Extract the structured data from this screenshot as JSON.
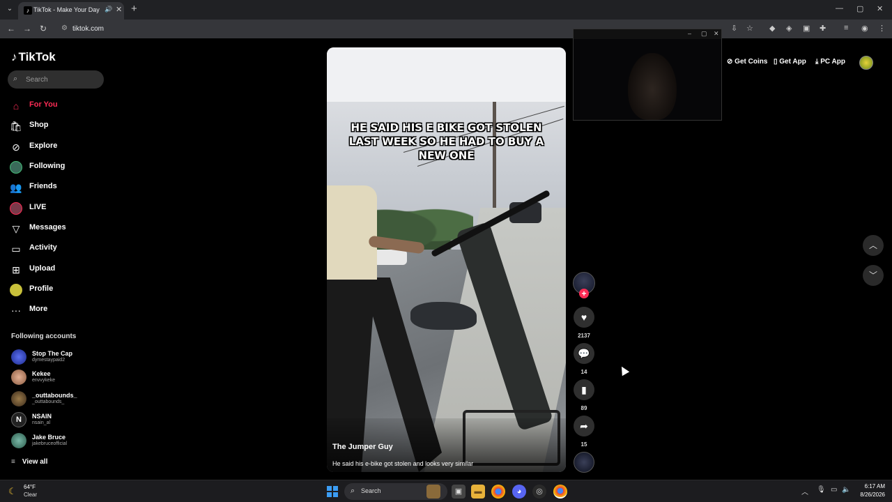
{
  "browser": {
    "tab_title": "TikTok - Make Your Day",
    "address": "tiktok.com"
  },
  "sidebar": {
    "logo": "TikTok",
    "search_placeholder": "Search",
    "nav": [
      {
        "label": "For You",
        "icon": "home-icon",
        "active": true
      },
      {
        "label": "Shop",
        "icon": "shopping-bag-icon"
      },
      {
        "label": "Explore",
        "icon": "compass-icon"
      },
      {
        "label": "Following",
        "icon": "following-avatar-icon"
      },
      {
        "label": "Friends",
        "icon": "friends-icon"
      },
      {
        "label": "LIVE",
        "icon": "live-avatar-icon"
      },
      {
        "label": "Messages",
        "icon": "send-icon"
      },
      {
        "label": "Activity",
        "icon": "inbox-icon"
      },
      {
        "label": "Upload",
        "icon": "plus-square-icon"
      },
      {
        "label": "Profile",
        "icon": "profile-avatar-icon"
      },
      {
        "label": "More",
        "icon": "more-dots-icon"
      }
    ],
    "following_title": "Following accounts",
    "accounts": [
      {
        "name": "Stop The Cap",
        "handle": "dymestaypaid2",
        "color": "#3a4fd6"
      },
      {
        "name": "Kekee",
        "handle": "envvykeke",
        "color": "#c98b6b"
      },
      {
        "name": "_outtabounds_",
        "handle": "_outtabounds_",
        "color": "#6a4a2a"
      },
      {
        "name": "NSAIN",
        "handle": "nsain_al",
        "color": "#2a2a2a"
      },
      {
        "name": "Jake Bruce",
        "handle": "jakebruceofficial",
        "color": "#4a8a7a"
      }
    ],
    "view_all": "View all"
  },
  "video": {
    "caption_overlay": "HE SAID HIS E BIKE GOT STOLEN LAST WEEK SO HE HAD TO BUY A NEW ONE",
    "author": "The Jumper Guy",
    "description": "He said his e-bike got stolen and looks very similar"
  },
  "actions": {
    "likes": "2137",
    "comments": "14",
    "saves": "89",
    "shares": "15"
  },
  "top_right": {
    "get_coins": "Get Coins",
    "get_app": "Get App",
    "pc_app": "PC App"
  },
  "taskbar": {
    "temperature": "64°F",
    "condition": "Clear",
    "search_label": "Search",
    "time": "6:17 AM",
    "date": "8/26/2026"
  },
  "colors": {
    "accent": "#fe2c55",
    "background": "#000000"
  }
}
